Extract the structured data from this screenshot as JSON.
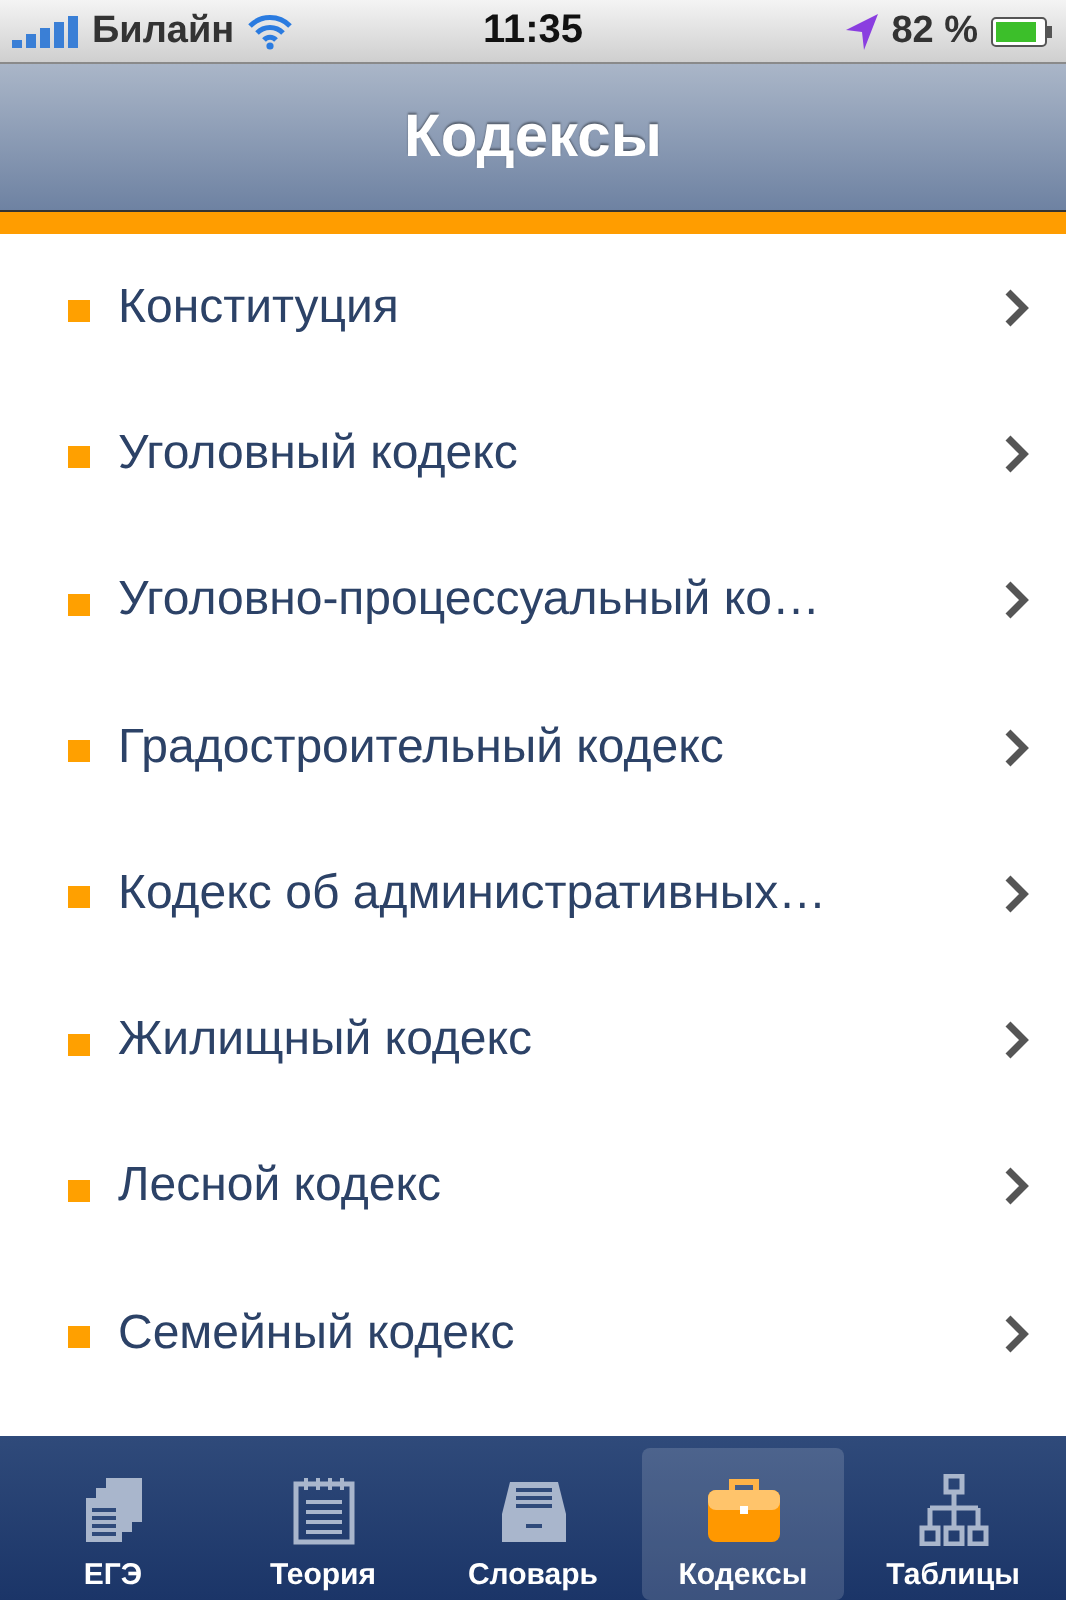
{
  "status_bar": {
    "carrier": "Билайн",
    "time": "11:35",
    "battery": "82 %"
  },
  "nav_bar": {
    "title": "Кодексы"
  },
  "list": {
    "items": [
      {
        "label": "Конституция"
      },
      {
        "label": "Уголовный кодекс"
      },
      {
        "label": "Уголовно-процессуальный ко…"
      },
      {
        "label": "Градостроительный кодекс"
      },
      {
        "label": "Кодекс об административных…"
      },
      {
        "label": "Жилищный кодекс"
      },
      {
        "label": "Лесной кодекс"
      },
      {
        "label": "Семейный кодекс"
      }
    ]
  },
  "tab_bar": {
    "tabs": [
      {
        "label": "ЕГЭ",
        "selected": false
      },
      {
        "label": "Теория",
        "selected": false
      },
      {
        "label": "Словарь",
        "selected": false
      },
      {
        "label": "Кодексы",
        "selected": true
      },
      {
        "label": "Таблицы",
        "selected": false
      }
    ]
  }
}
